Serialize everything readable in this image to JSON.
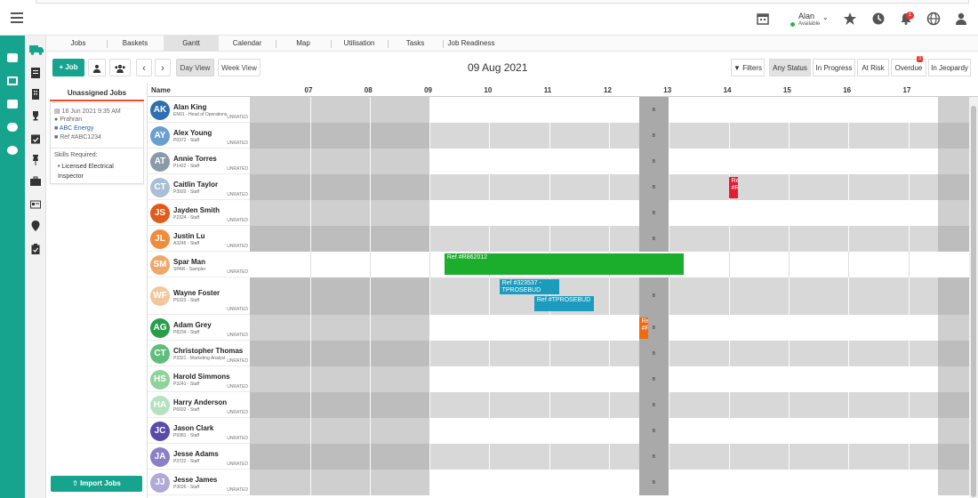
{
  "header": {
    "user_name": "Alan",
    "user_status": "Available",
    "notification_count": "1"
  },
  "tabs": [
    {
      "label": "Jobs"
    },
    {
      "label": "Baskets"
    },
    {
      "label": "Gantt",
      "active": true
    },
    {
      "label": "Calendar"
    },
    {
      "label": "Map"
    },
    {
      "label": "Utilisation"
    },
    {
      "label": "Tasks"
    },
    {
      "label": "Job Readiness"
    }
  ],
  "toolbar": {
    "add_job_label": "+ Job",
    "day_view_label": "Day View",
    "week_view_label": "Week View",
    "date": "09 Aug 2021",
    "filters_label": "Filters",
    "status_filters": [
      "Any Status",
      "In Progress",
      "At Risk",
      "Overdue",
      "In Jeopardy"
    ],
    "overdue_count": "3"
  },
  "unassigned": {
    "title": "Unassigned Jobs",
    "job": {
      "date": "16 Jun 2021 9:35 AM",
      "location": "Prahran",
      "customer": "ABC Energy",
      "ref": "Ref #ABC1234",
      "skills_title": "Skills Required:",
      "skills": [
        "Licensed Electrical Inspector"
      ]
    },
    "import_label": "Import Jobs"
  },
  "gantt": {
    "name_header": "Name",
    "hours": [
      "07",
      "08",
      "09",
      "10",
      "11",
      "12",
      "13",
      "14",
      "15",
      "16",
      "17"
    ],
    "break_marker": "B",
    "resources": [
      {
        "initials": "AK",
        "name": "Alan King",
        "role": "EN01 - Head of Operations",
        "rating": "UNRATED",
        "color": "#2f6fb0"
      },
      {
        "initials": "AY",
        "name": "Alex Young",
        "role": "P0372 - Staff",
        "rating": "UNRATED",
        "color": "#6a9fd0"
      },
      {
        "initials": "AT",
        "name": "Annie Torres",
        "role": "P1422 - Staff",
        "rating": "UNRATED",
        "color": "#8a9aa8"
      },
      {
        "initials": "CT",
        "name": "Caitlin Taylor",
        "role": "P3920 - Staff",
        "rating": "UNRATED",
        "color": "#a8bfd8"
      },
      {
        "initials": "JS",
        "name": "Jayden Smith",
        "role": "P2324 - Staff",
        "rating": "UNRATED",
        "color": "#e35a1a"
      },
      {
        "initials": "JL",
        "name": "Justin Lu",
        "role": "A3245 - Staff",
        "rating": "UNRATED",
        "color": "#f08c3a"
      },
      {
        "initials": "SM",
        "name": "Spar Man",
        "role": "SPAR - Sampler",
        "rating": "UNRATED",
        "color": "#f0a868"
      },
      {
        "initials": "WF",
        "name": "Wayne Foster",
        "role": "P5323 - Staff",
        "rating": "UNRATED",
        "color": "#f3c79c"
      },
      {
        "initials": "AG",
        "name": "Adam Grey",
        "role": "P8234 - Staff",
        "rating": "UNRATED",
        "color": "#2a9d4b"
      },
      {
        "initials": "CT",
        "name": "Christopher Thomas",
        "role": "P3321 - Marketing Analyst",
        "rating": "UNRATED",
        "color": "#5fbf7a"
      },
      {
        "initials": "HS",
        "name": "Harold Simmons",
        "role": "P3241 - Staff",
        "rating": "UNRATED",
        "color": "#8ed29c"
      },
      {
        "initials": "HA",
        "name": "Harry Anderson",
        "role": "P6932 - Staff",
        "rating": "UNRATED",
        "color": "#b5e2bd"
      },
      {
        "initials": "JC",
        "name": "Jason Clark",
        "role": "P9381 - Staff",
        "rating": "UNRATED",
        "color": "#5a4ba8"
      },
      {
        "initials": "JA",
        "name": "Jesse Adams",
        "role": "P3722 - Staff",
        "rating": "UNRATED",
        "color": "#8a7fc8"
      },
      {
        "initials": "JJ",
        "name": "Jesse James",
        "role": "P3026 - Staff",
        "rating": "UNRATED",
        "color": "#b1aad8"
      }
    ],
    "jobs": [
      {
        "row": 3,
        "label": "Ref #R",
        "color": "#e81c30",
        "start": "14:00",
        "end": "14:09"
      },
      {
        "row": 6,
        "label": "Ref #R862012",
        "color": "#1aae2c",
        "start": "09:15",
        "end": "13:15"
      },
      {
        "row": 7,
        "label": "Ref #323537 - TPROSEBUD",
        "color": "#1b9bbd",
        "start": "10:10",
        "end": "11:10"
      },
      {
        "row": 7,
        "label": "Ref #TPROSEBUD",
        "color": "#1b9bbd",
        "start": "10:45",
        "end": "11:45"
      },
      {
        "row": 8,
        "label": "Ref #F",
        "color": "#f26a10",
        "start": "12:30",
        "end": "12:39"
      }
    ]
  }
}
